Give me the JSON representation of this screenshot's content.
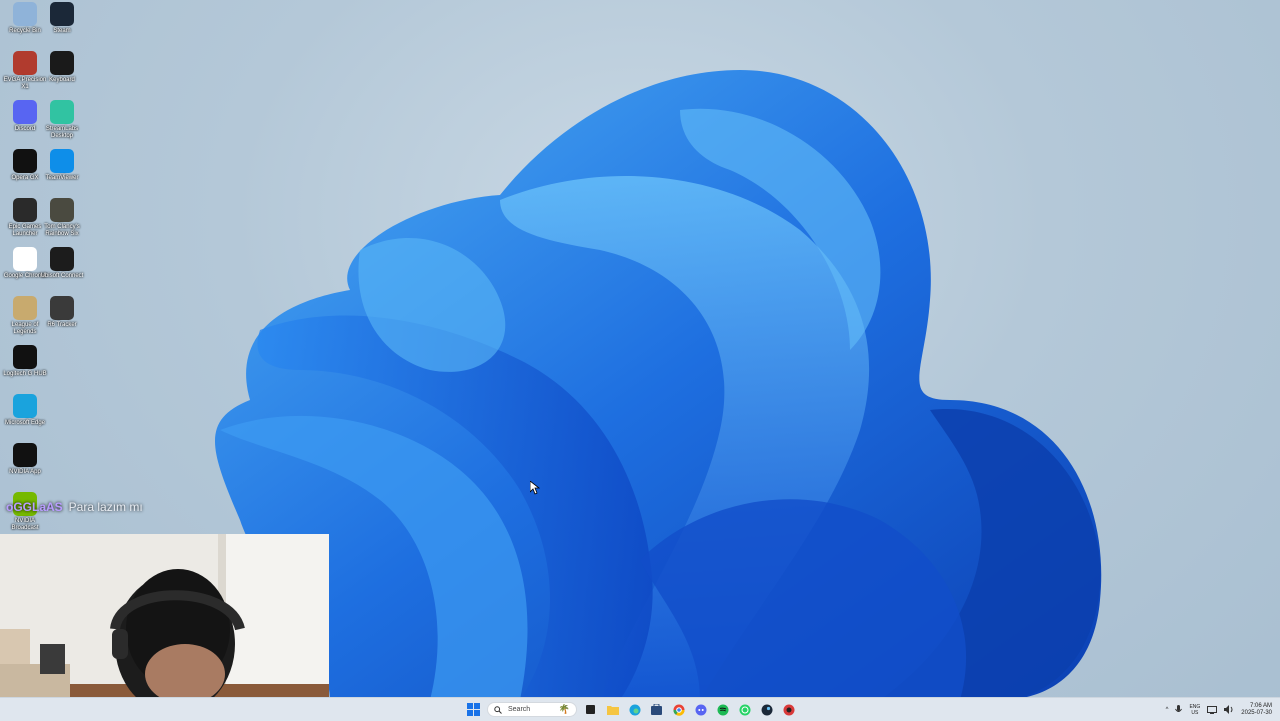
{
  "desktop": {
    "icons": [
      {
        "label": "Recycle Bin",
        "icon": "recycle-bin-icon",
        "color": "#8fb3d9"
      },
      {
        "label": "Steam",
        "icon": "steam-icon",
        "color": "#1b2838"
      },
      {
        "label": "EVGA Precision X1",
        "icon": "evga-icon",
        "color": "#b13b2e"
      },
      {
        "label": "Keyboard",
        "icon": "keyboard-icon",
        "color": "#1a1a1a"
      },
      {
        "label": "Discord",
        "icon": "discord-icon",
        "color": "#5865f2"
      },
      {
        "label": "StreamLabs Desktop",
        "icon": "streamlabs-icon",
        "color": "#31c3a2"
      },
      {
        "label": "Opera GX",
        "icon": "threads-icon",
        "color": "#111111"
      },
      {
        "label": "TeamViewer",
        "icon": "teamviewer-icon",
        "color": "#0e8ee9"
      },
      {
        "label": "Epic Games Launcher",
        "icon": "epic-games-icon",
        "color": "#2a2a2a"
      },
      {
        "label": "Tom Clancy's Rainbow Six",
        "icon": "rainbow-six-game-icon",
        "color": "#4a4a40"
      },
      {
        "label": "Google Chrome",
        "icon": "chrome-icon",
        "color": "#ffffff"
      },
      {
        "label": "Ubisoft Connect",
        "icon": "ubisoft-icon",
        "color": "#1c1c1c"
      },
      {
        "label": "League of Legends",
        "icon": "league-icon",
        "color": "#c8aa6e"
      },
      {
        "label": "R6 Tracker",
        "icon": "r6-tracker-icon",
        "color": "#3a3a3a"
      },
      {
        "label": "Logitech G HUB",
        "icon": "logitech-icon",
        "color": "#111111"
      },
      {
        "label": "Microsoft Edge",
        "icon": "edge-icon",
        "color": "#1aa3dd"
      },
      {
        "label": "NVIDIA App",
        "icon": "nvidia-app-icon",
        "color": "#111111"
      },
      {
        "label": "NVIDIA Broadcast",
        "icon": "nvidia-broadcast-icon",
        "color": "#76b900"
      }
    ]
  },
  "chat": {
    "user": "oGGLaAS",
    "message": "Para lazım mı"
  },
  "taskbar": {
    "search_placeholder": "Search",
    "tray_lang": "ENG",
    "tray_region": "US",
    "time": "7:06 AM",
    "date": "2025-07-30"
  }
}
